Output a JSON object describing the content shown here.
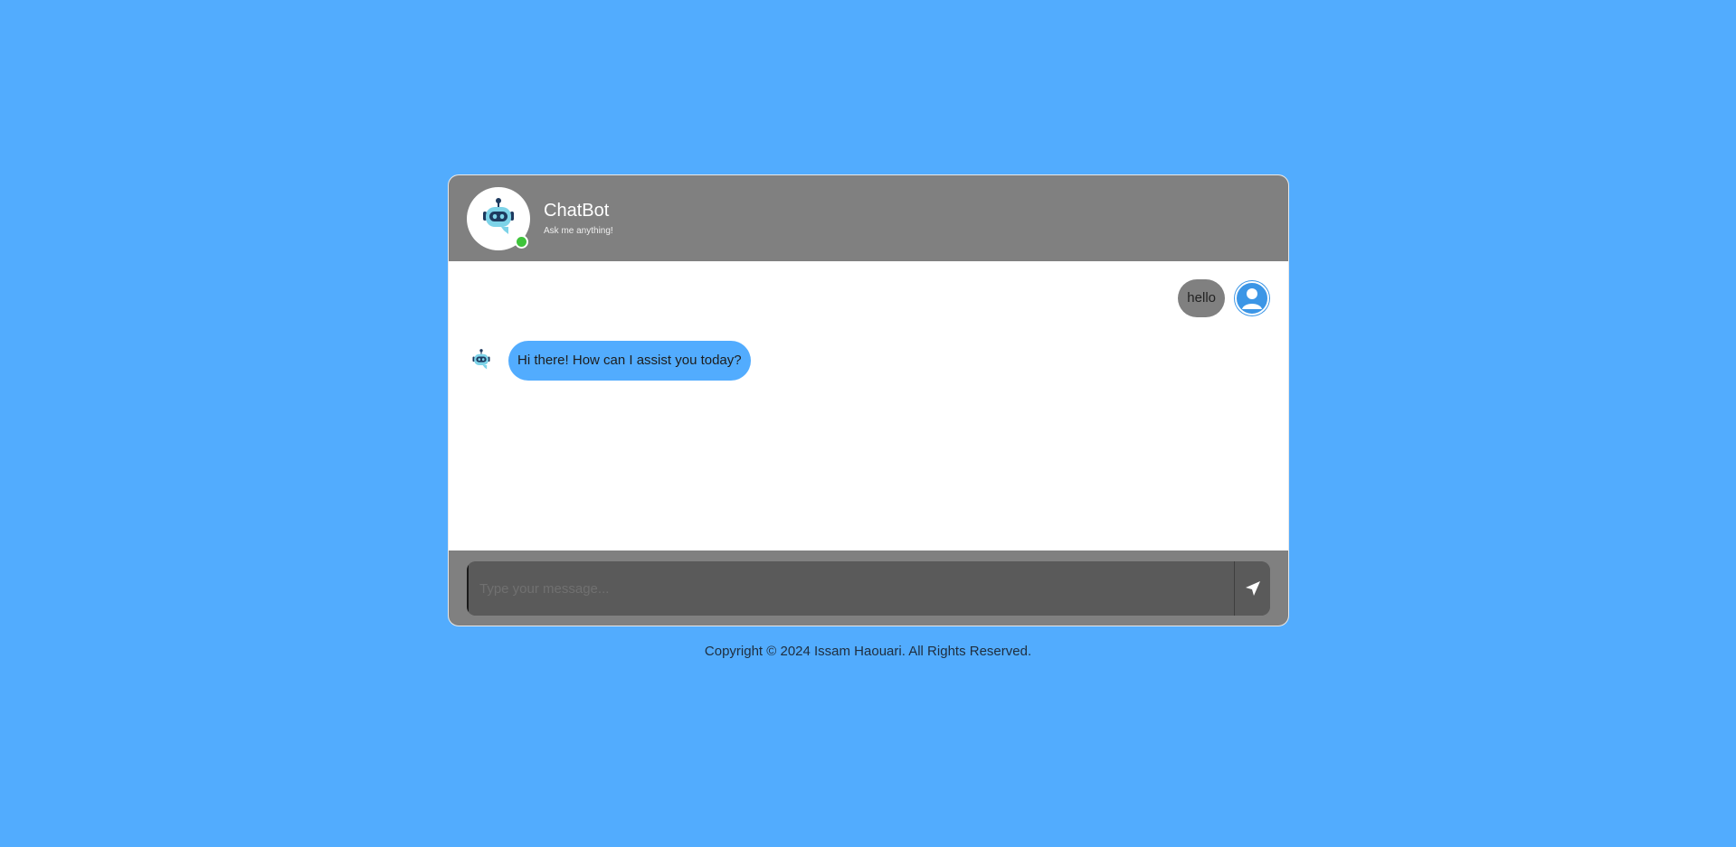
{
  "header": {
    "title": "ChatBot",
    "subtitle": "Ask me anything!",
    "status_color": "#3fc43b",
    "bot_icon": "robot-icon"
  },
  "messages": [
    {
      "sender": "user",
      "text": "hello",
      "avatar_icon": "user-icon"
    },
    {
      "sender": "bot",
      "text": "Hi there! How can I assist you today?",
      "avatar_icon": "robot-icon"
    }
  ],
  "input": {
    "placeholder": "Type your message...",
    "value": "",
    "send_icon": "send-icon"
  },
  "footer": {
    "copyright": "Copyright © 2024 Issam Haouari. All Rights Reserved."
  },
  "colors": {
    "background": "#52acfe",
    "header": "#808080",
    "user_bubble": "#808080",
    "bot_bubble": "#52acfe",
    "input_bg": "#5a5a5a"
  }
}
